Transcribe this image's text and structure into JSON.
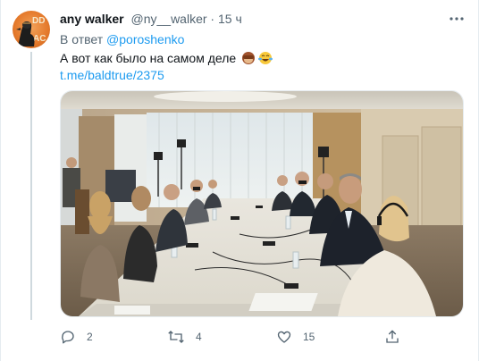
{
  "tweet": {
    "author_name": "any walker",
    "author_handle": "@ny__walker",
    "separator": " · ",
    "time": "15 ч",
    "reply_prefix": "В ответ ",
    "reply_to": "@poroshenko",
    "text": "А вот как было на самом деле",
    "emojis": [
      "see-no-evil-monkey",
      "face-with-tears-of-joy"
    ],
    "link": "t.me/baldtrue/2375",
    "avatar_text": "DD AC",
    "photo_description_name": "meeting-room-photo"
  },
  "actions": {
    "replies": "2",
    "retweets": "4",
    "likes": "15",
    "share": ""
  },
  "colors": {
    "link": "#1d9bf0",
    "text": "#0f1419",
    "secondary": "#536471"
  }
}
